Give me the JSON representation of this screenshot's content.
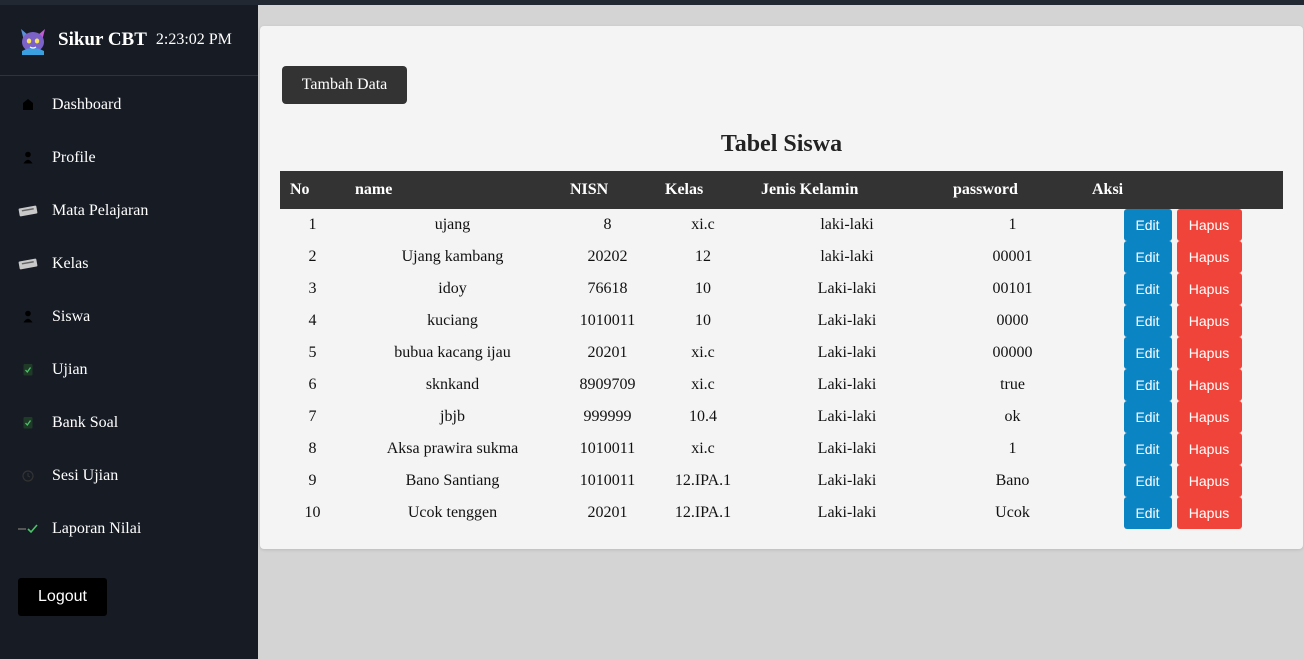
{
  "app": {
    "title": "Sikur CBT",
    "clock": "2:23:02 PM"
  },
  "sidebar": {
    "items": [
      {
        "label": "Dashboard",
        "icon": "home-icon"
      },
      {
        "label": "Profile",
        "icon": "user-icon"
      },
      {
        "label": "Mata Pelajaran",
        "icon": "ticket-icon"
      },
      {
        "label": "Kelas",
        "icon": "ticket-icon"
      },
      {
        "label": "Siswa",
        "icon": "user-icon"
      },
      {
        "label": "Ujian",
        "icon": "clipboard-icon"
      },
      {
        "label": "Bank Soal",
        "icon": "clipboard-icon"
      },
      {
        "label": "Sesi Ujian",
        "icon": "clock-icon"
      },
      {
        "label": "Laporan Nilai",
        "icon": "chart-check-icon"
      }
    ],
    "logout_label": "Logout"
  },
  "main": {
    "add_button_label": "Tambah Data",
    "table_title": "Tabel Siswa",
    "columns": [
      "No",
      "name",
      "NISN",
      "Kelas",
      "Jenis Kelamin",
      "password",
      "Aksi"
    ],
    "edit_label": "Edit",
    "delete_label": "Hapus",
    "rows": [
      {
        "no": "1",
        "name": "ujang",
        "nisn": "8",
        "kelas": "xi.c",
        "jenis_kelamin": "laki-laki",
        "password": "1"
      },
      {
        "no": "2",
        "name": "Ujang kambang",
        "nisn": "20202",
        "kelas": "12",
        "jenis_kelamin": "laki-laki",
        "password": "00001"
      },
      {
        "no": "3",
        "name": "idoy",
        "nisn": "76618",
        "kelas": "10",
        "jenis_kelamin": "Laki-laki",
        "password": "00101"
      },
      {
        "no": "4",
        "name": "kuciang",
        "nisn": "1010011",
        "kelas": "10",
        "jenis_kelamin": "Laki-laki",
        "password": "0000"
      },
      {
        "no": "5",
        "name": "bubua kacang ijau",
        "nisn": "20201",
        "kelas": "xi.c",
        "jenis_kelamin": "Laki-laki",
        "password": "00000"
      },
      {
        "no": "6",
        "name": "sknkand",
        "nisn": "8909709",
        "kelas": "xi.c",
        "jenis_kelamin": "Laki-laki",
        "password": "true"
      },
      {
        "no": "7",
        "name": "jbjb",
        "nisn": "999999",
        "kelas": "10.4",
        "jenis_kelamin": "Laki-laki",
        "password": "ok"
      },
      {
        "no": "8",
        "name": "Aksa prawira sukma",
        "nisn": "1010011",
        "kelas": "xi.c",
        "jenis_kelamin": "Laki-laki",
        "password": "1"
      },
      {
        "no": "9",
        "name": "Bano Santiang",
        "nisn": "1010011",
        "kelas": "12.IPA.1",
        "jenis_kelamin": "Laki-laki",
        "password": "Bano"
      },
      {
        "no": "10",
        "name": "Ucok tenggen",
        "nisn": "20201",
        "kelas": "12.IPA.1",
        "jenis_kelamin": "Laki-laki",
        "password": "Ucok"
      }
    ]
  },
  "colors": {
    "sidebar_bg": "#161b24",
    "header_bg": "#333333",
    "edit_button": "#0b84c4",
    "delete_button": "#f0443a",
    "page_bg": "#d4d4d4"
  }
}
